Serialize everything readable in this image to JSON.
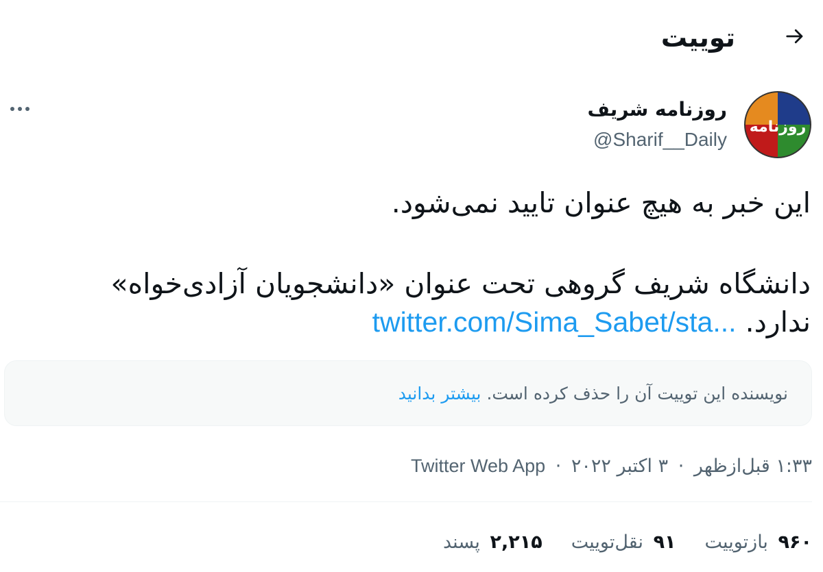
{
  "header": {
    "title": "توییت",
    "back_icon": "arrow-right-icon"
  },
  "author": {
    "name": "روزنامه شریف",
    "handle": "@Sharif__Daily",
    "avatar_text": "روزنامه",
    "avatar_colors": [
      "#e58a1f",
      "#1f3c8a",
      "#c01a1a",
      "#2e8b2e"
    ]
  },
  "tweet": {
    "line1": "این خبر به هیچ عنوان تایید نمی‌شود.",
    "line2": "دانشگاه شریف گروهی تحت عنوان «دانشجویان آزادی‌خواه»",
    "line3": "ندارد.",
    "link": "twitter.com/Sima_Sabet/sta..."
  },
  "notice": {
    "text": "نویسنده این توییت آن را حذف کرده است.",
    "link": "بیشتر بدانید"
  },
  "meta": {
    "time": "۱:۳۳ قبل‌ازظهر",
    "date": "۳ اکتبر ۲۰۲۲",
    "source": "Twitter Web App",
    "separator": "·"
  },
  "stats": {
    "retweets_count": "۹۶۰",
    "retweets_label": "بازتوییت",
    "quotes_count": "۹۱",
    "quotes_label": "نقل‌توییت",
    "likes_count": "۲,۲۱۵",
    "likes_label": "پسند"
  },
  "colors": {
    "link": "#1d9bf0",
    "secondary_text": "#536471",
    "primary_text": "#0f1419"
  }
}
